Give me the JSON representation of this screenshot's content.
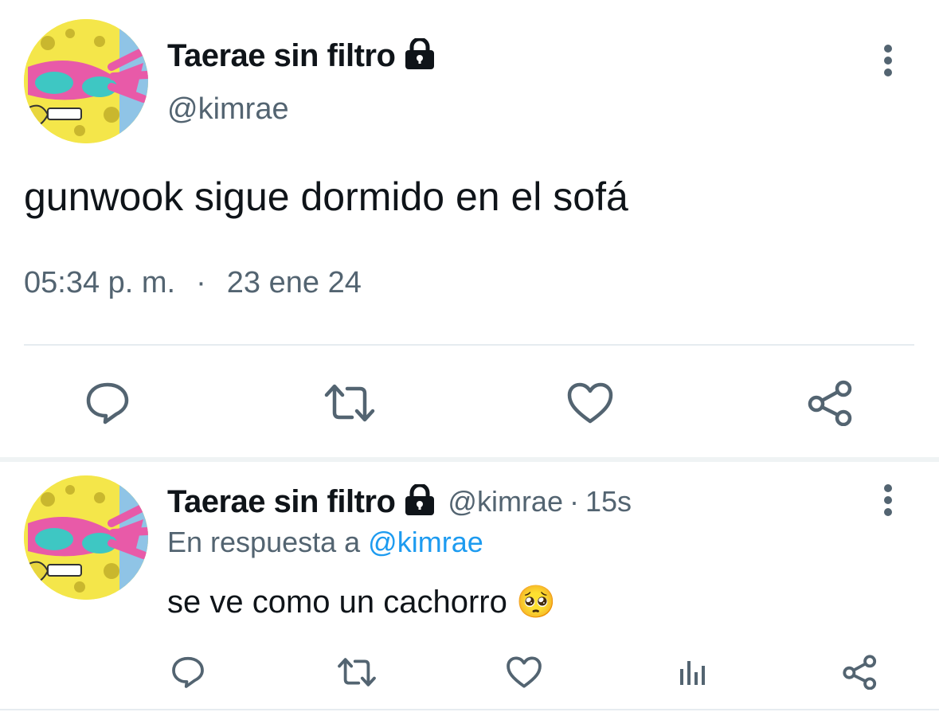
{
  "main_tweet": {
    "display_name": "Taerae sin filtro",
    "handle": "@kimrae",
    "text": "gunwook sigue dormido en el sofá",
    "time": "05:34 p. m.",
    "separator": "·",
    "date": "23 ene 24",
    "avatar_icon": "spongebob-avatar",
    "lock_icon": "lock-icon",
    "more_icon": "more-vertical-icon",
    "actions": [
      "reply-icon",
      "retweet-icon",
      "like-icon",
      "share-icon"
    ]
  },
  "reply_tweet": {
    "display_name": "Taerae sin filtro",
    "handle": "@kimrae",
    "separator": "·",
    "age": "15s",
    "reply_prefix": "En respuesta a",
    "reply_to": "@kimrae",
    "text": "se ve como un cachorro",
    "emoji": "🥺",
    "avatar_icon": "spongebob-avatar",
    "lock_icon": "lock-icon",
    "more_icon": "more-vertical-icon",
    "actions": [
      "reply-icon",
      "retweet-icon",
      "like-icon",
      "analytics-icon",
      "share-icon"
    ]
  },
  "colors": {
    "text": "#0f1419",
    "muted": "#536471",
    "link": "#1d9bf0",
    "icon": "#536471",
    "divider": "#e6ecf0"
  }
}
